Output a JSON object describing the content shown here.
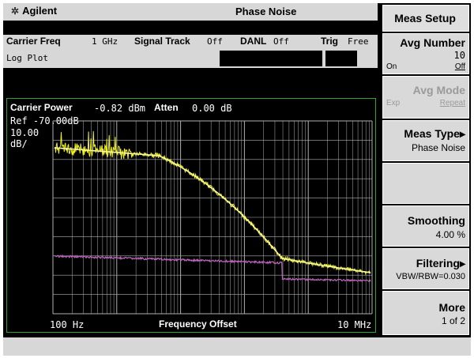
{
  "header": {
    "logo": "Agilent",
    "title": "Phase Noise",
    "logo_icon": "star-icon"
  },
  "status": {
    "carrier_freq_label": "Carrier Freq",
    "carrier_freq_value": "1 GHz",
    "signal_track_label": "Signal Track",
    "signal_track_value": "Off",
    "danl_label": "DANL",
    "danl_value": "Off",
    "trig_label": "Trig",
    "trig_value": "Free",
    "view": "Log Plot"
  },
  "plot": {
    "carrier_power_label": "Carrier Power",
    "carrier_power_value": "-0.82 dBm",
    "atten_label": "Atten",
    "atten_value": "0.00 dB",
    "ref": "Ref -70.00dB",
    "scale_value": "10.00",
    "scale_unit": "dB/",
    "x_start": "100 Hz",
    "x_label": "Frequency Offset",
    "x_stop": "10 MHz",
    "colors": {
      "trace_raw": "#f0f020",
      "trace_smoothed": "#f8f8a0",
      "trace_noise": "#c066c0",
      "grid": "#b0b0b0",
      "border": "#2fa52f"
    }
  },
  "softkeys": {
    "menu_title": "Meas Setup",
    "avg_number": {
      "label": "Avg Number",
      "value": "10",
      "on": "On",
      "off": "Off"
    },
    "avg_mode": {
      "label": "Avg Mode",
      "exp": "Exp",
      "repeat": "Repeat"
    },
    "meas_type": {
      "label": "Meas Type",
      "value": "Phase Noise"
    },
    "smoothing": {
      "label": "Smoothing",
      "value": "4.00 %"
    },
    "filtering": {
      "label": "Filtering",
      "value": "VBW/RBW=0.030"
    },
    "more": {
      "label": "More",
      "value": "1 of 2"
    }
  }
}
